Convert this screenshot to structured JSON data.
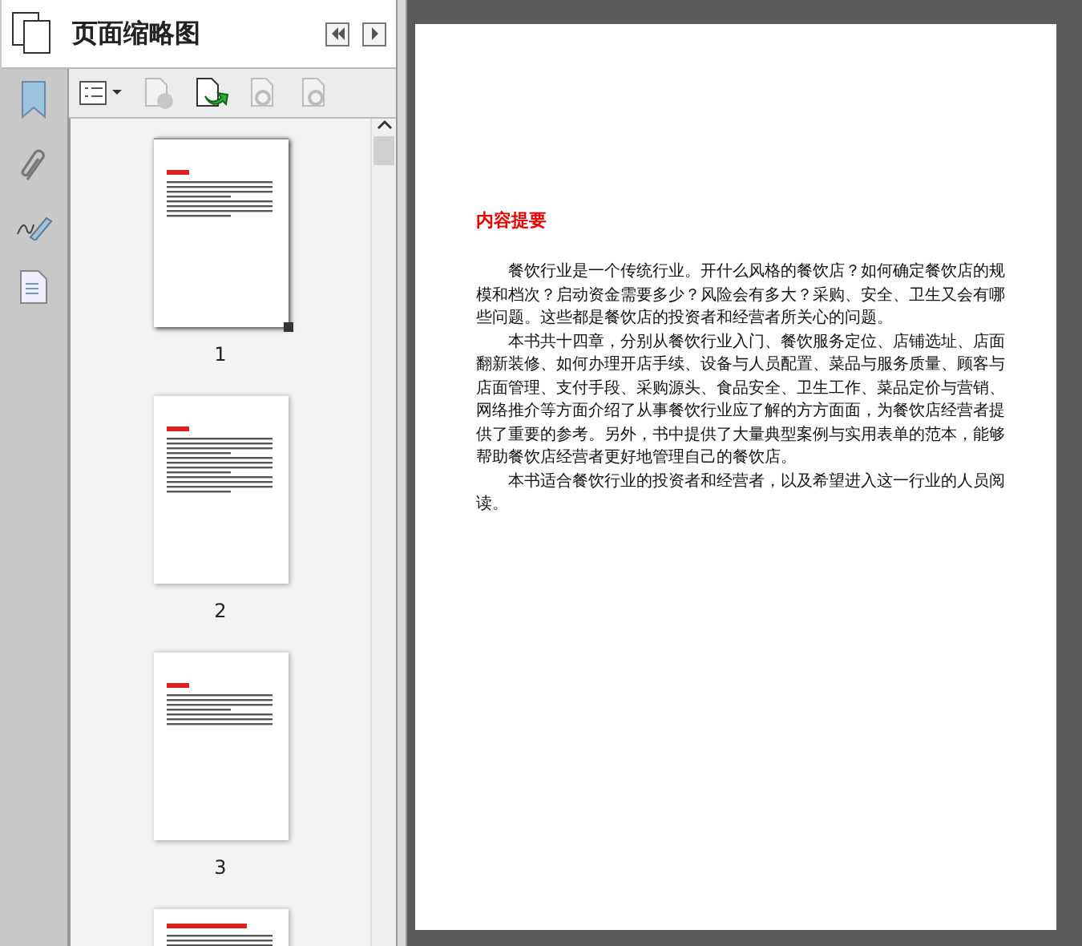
{
  "panel": {
    "title": "页面缩略图"
  },
  "thumbnails": [
    {
      "number": "1",
      "selected": true
    },
    {
      "number": "2",
      "selected": false
    },
    {
      "number": "3",
      "selected": false
    },
    {
      "selected": false
    }
  ],
  "document": {
    "heading": "内容提要",
    "paragraphs": [
      "餐饮行业是一个传统行业。开什么风格的餐饮店？如何确定餐饮店的规模和档次？启动资金需要多少？风险会有多大？采购、安全、卫生又会有哪些问题。这些都是餐饮店的投资者和经营者所关心的问题。",
      "本书共十四章，分别从餐饮行业入门、餐饮服务定位、店铺选址、店面翻新装修、如何办理开店手续、设备与人员配置、菜品与服务质量、顾客与店面管理、支付手段、采购源头、食品安全、卫生工作、菜品定价与营销、网络推介等方面介绍了从事餐饮行业应了解的方方面面，为餐饮店经营者提供了重要的参考。另外，书中提供了大量典型案例与实用表单的范本，能够帮助餐饮店经营者更好地管理自己的餐饮店。",
      "本书适合餐饮行业的投资者和经营者，以及希望进入这一行业的人员阅读。"
    ]
  }
}
